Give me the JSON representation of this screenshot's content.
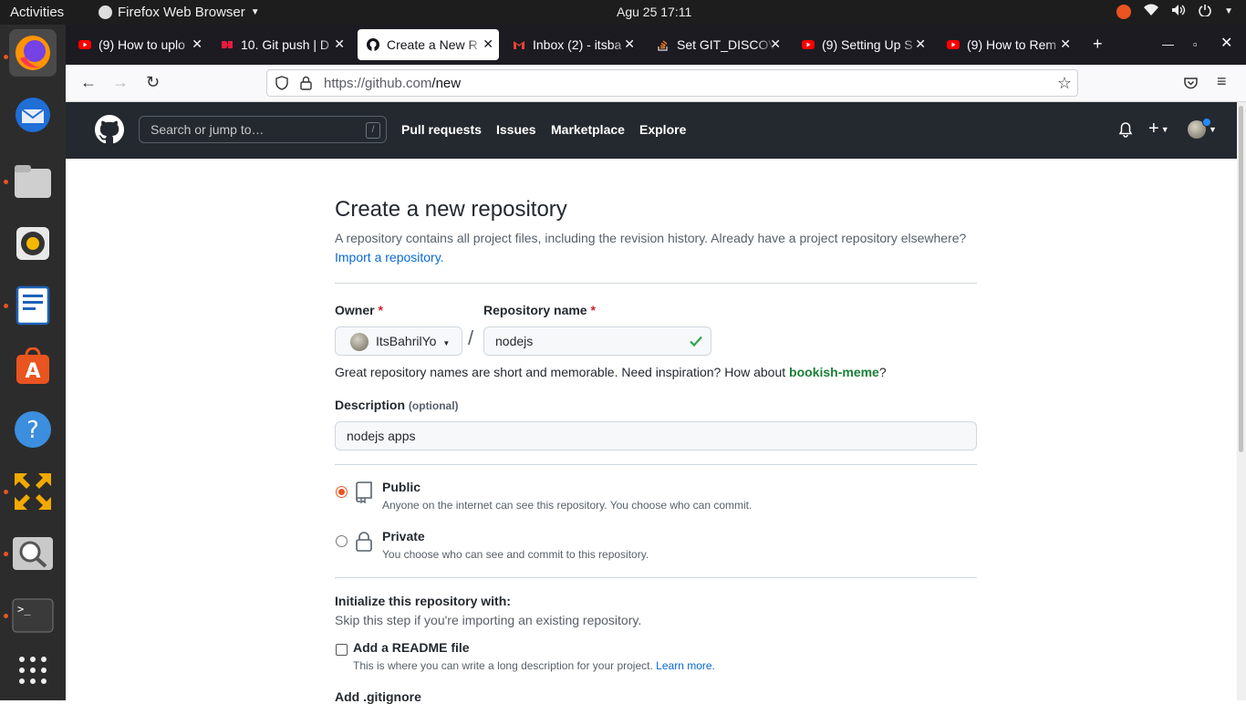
{
  "system_bar": {
    "activities": "Activities",
    "app_name": "Firefox Web Browser",
    "clock": "Agu 25  17:11"
  },
  "browser": {
    "tabs": [
      {
        "title": "(9) How to uplo",
        "icon": "youtube-icon"
      },
      {
        "title": "10. Git push | D",
        "icon": "dicoding-icon"
      },
      {
        "title": "Create a New R",
        "icon": "github-icon",
        "active": true
      },
      {
        "title": "Inbox (2) - itsba",
        "icon": "gmail-icon"
      },
      {
        "title": "Set GIT_DISCOV",
        "icon": "stackoverflow-icon"
      },
      {
        "title": "(9) Setting Up S",
        "icon": "youtube-icon"
      },
      {
        "title": "(9) How to Rem",
        "icon": "youtube-icon"
      }
    ],
    "url_host": "https://github.com",
    "url_path": "/new"
  },
  "github_header": {
    "search_placeholder": "Search or jump to…",
    "search_shortcut": "/",
    "nav": [
      "Pull requests",
      "Issues",
      "Marketplace",
      "Explore"
    ]
  },
  "page": {
    "title": "Create a new repository",
    "subtitle": "A repository contains all project files, including the revision history. Already have a project repository elsewhere?",
    "import_link": "Import a repository.",
    "owner_label": "Owner",
    "owner_value": "ItsBahrilYo",
    "repo_name_label": "Repository name",
    "repo_name_value": "nodejs",
    "separator": "/",
    "name_hint_prefix": "Great repository names are short and memorable. Need inspiration? How about ",
    "name_suggestion": "bookish-meme",
    "name_hint_suffix": "?",
    "description_label": "Description",
    "description_optional": "(optional)",
    "description_value": "nodejs apps",
    "visibility": [
      {
        "label": "Public",
        "desc": "Anyone on the internet can see this repository. You choose who can commit.",
        "selected": true
      },
      {
        "label": "Private",
        "desc": "You choose who can see and commit to this repository.",
        "selected": false
      }
    ],
    "init_title": "Initialize this repository with:",
    "init_sub": "Skip this step if you're importing an existing repository.",
    "readme_label": "Add a README file",
    "readme_desc": "This is where you can write a long description for your project.",
    "learn_more": "Learn more.",
    "gitignore_label": "Add .gitignore"
  },
  "colors": {
    "accent": "#e95420",
    "github_dark": "#24292f",
    "link": "#0969da",
    "success": "#2da44e"
  }
}
